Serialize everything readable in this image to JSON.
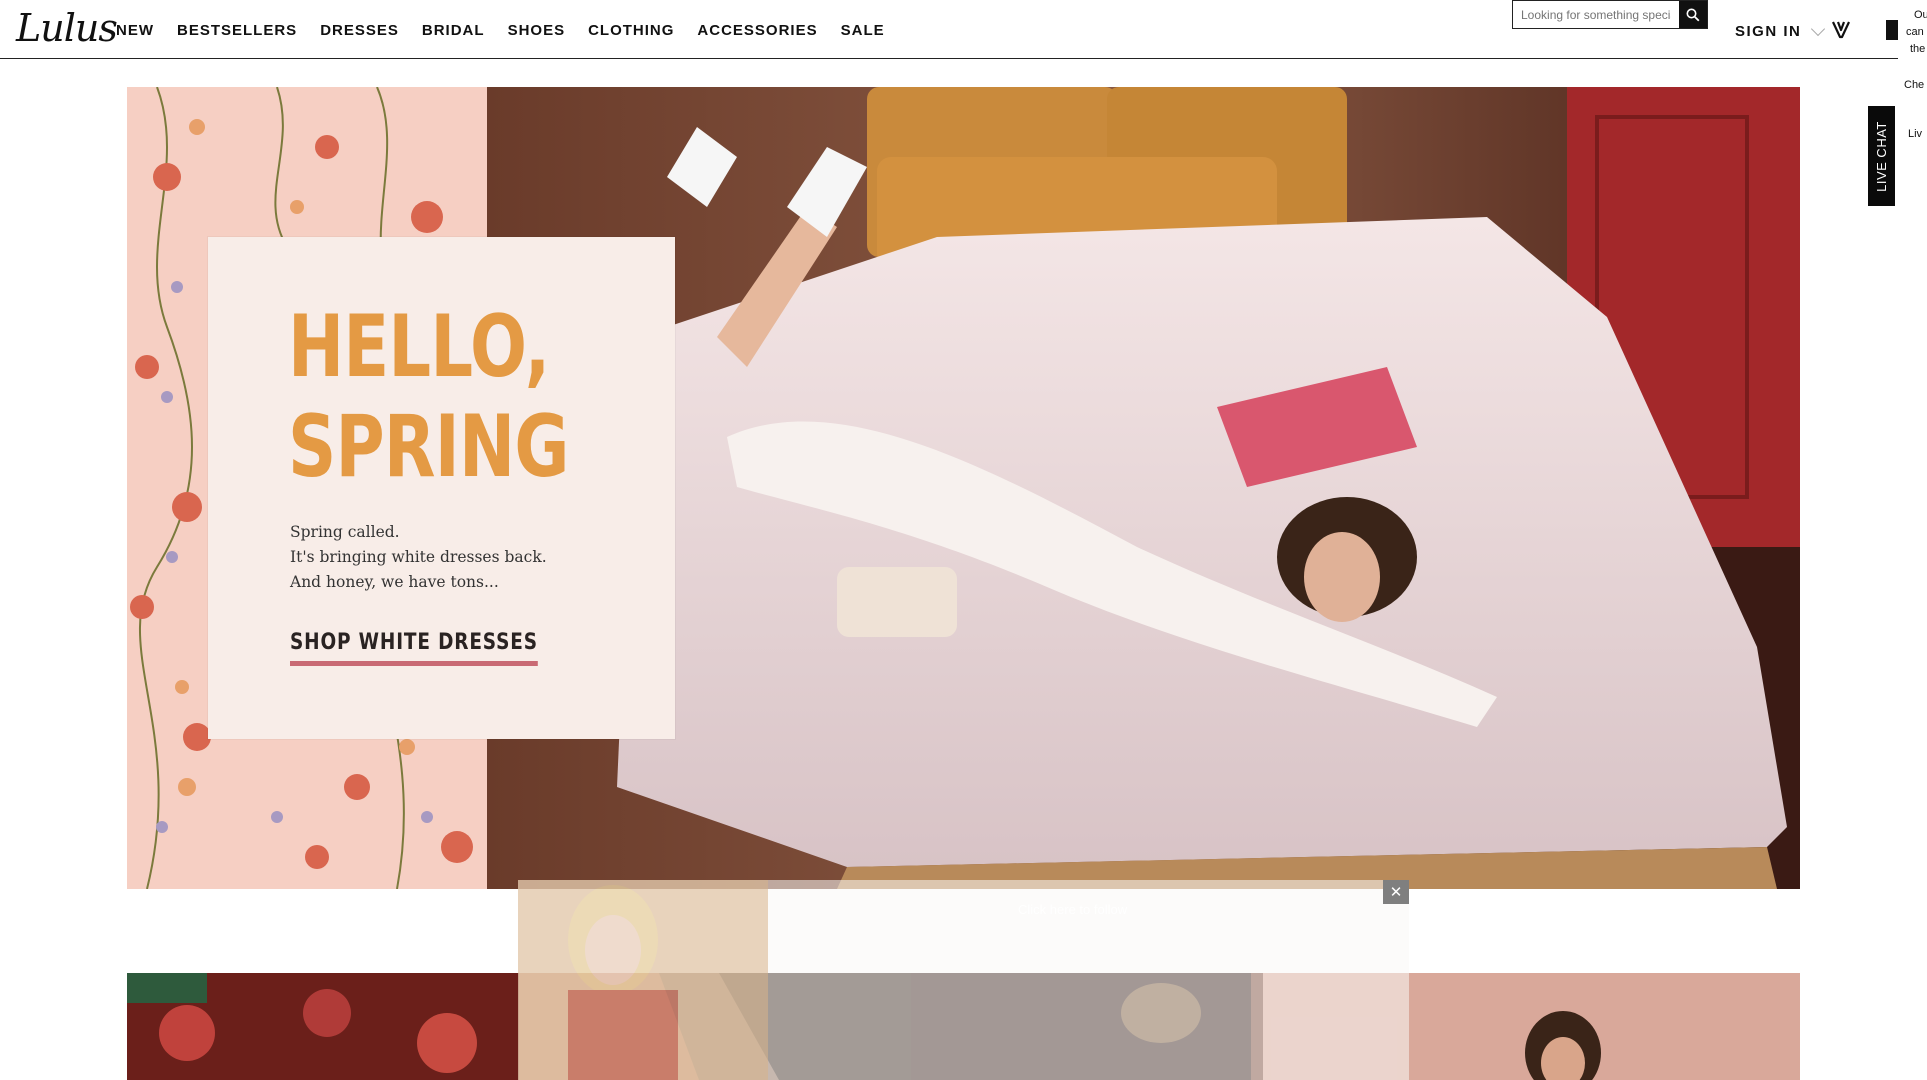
{
  "brand": {
    "logo_text": "Lulus"
  },
  "nav": {
    "items": [
      {
        "label": "NEW"
      },
      {
        "label": "BESTSELLERS"
      },
      {
        "label": "DRESSES"
      },
      {
        "label": "BRIDAL"
      },
      {
        "label": "SHOES"
      },
      {
        "label": "CLOTHING"
      },
      {
        "label": "ACCESSORIES"
      },
      {
        "label": "SALE"
      }
    ]
  },
  "search": {
    "placeholder": "Looking for something special?"
  },
  "account": {
    "sign_in": "SIGN IN"
  },
  "edge_panel": {
    "line1": "Ou",
    "line2": "can",
    "line3": "the",
    "line4": "Che",
    "line5": "Liv"
  },
  "live_chat": {
    "label": "LIVE CHAT"
  },
  "hero": {
    "headline_line1": "HELLO,",
    "headline_line2": "SPRING",
    "body_line1": "Spring called.",
    "body_line2": "It's bringing white dresses back.",
    "body_line3": "And honey, we have tons...",
    "cta": "SHOP WHITE DRESSES"
  },
  "overlay": {
    "caption": "Click here to follow"
  },
  "colors": {
    "headline": "#e49a44",
    "cta_underline": "#c96a74",
    "card_bg": "#f8ede8",
    "wallpaper_bg": "#f6cfc3"
  }
}
